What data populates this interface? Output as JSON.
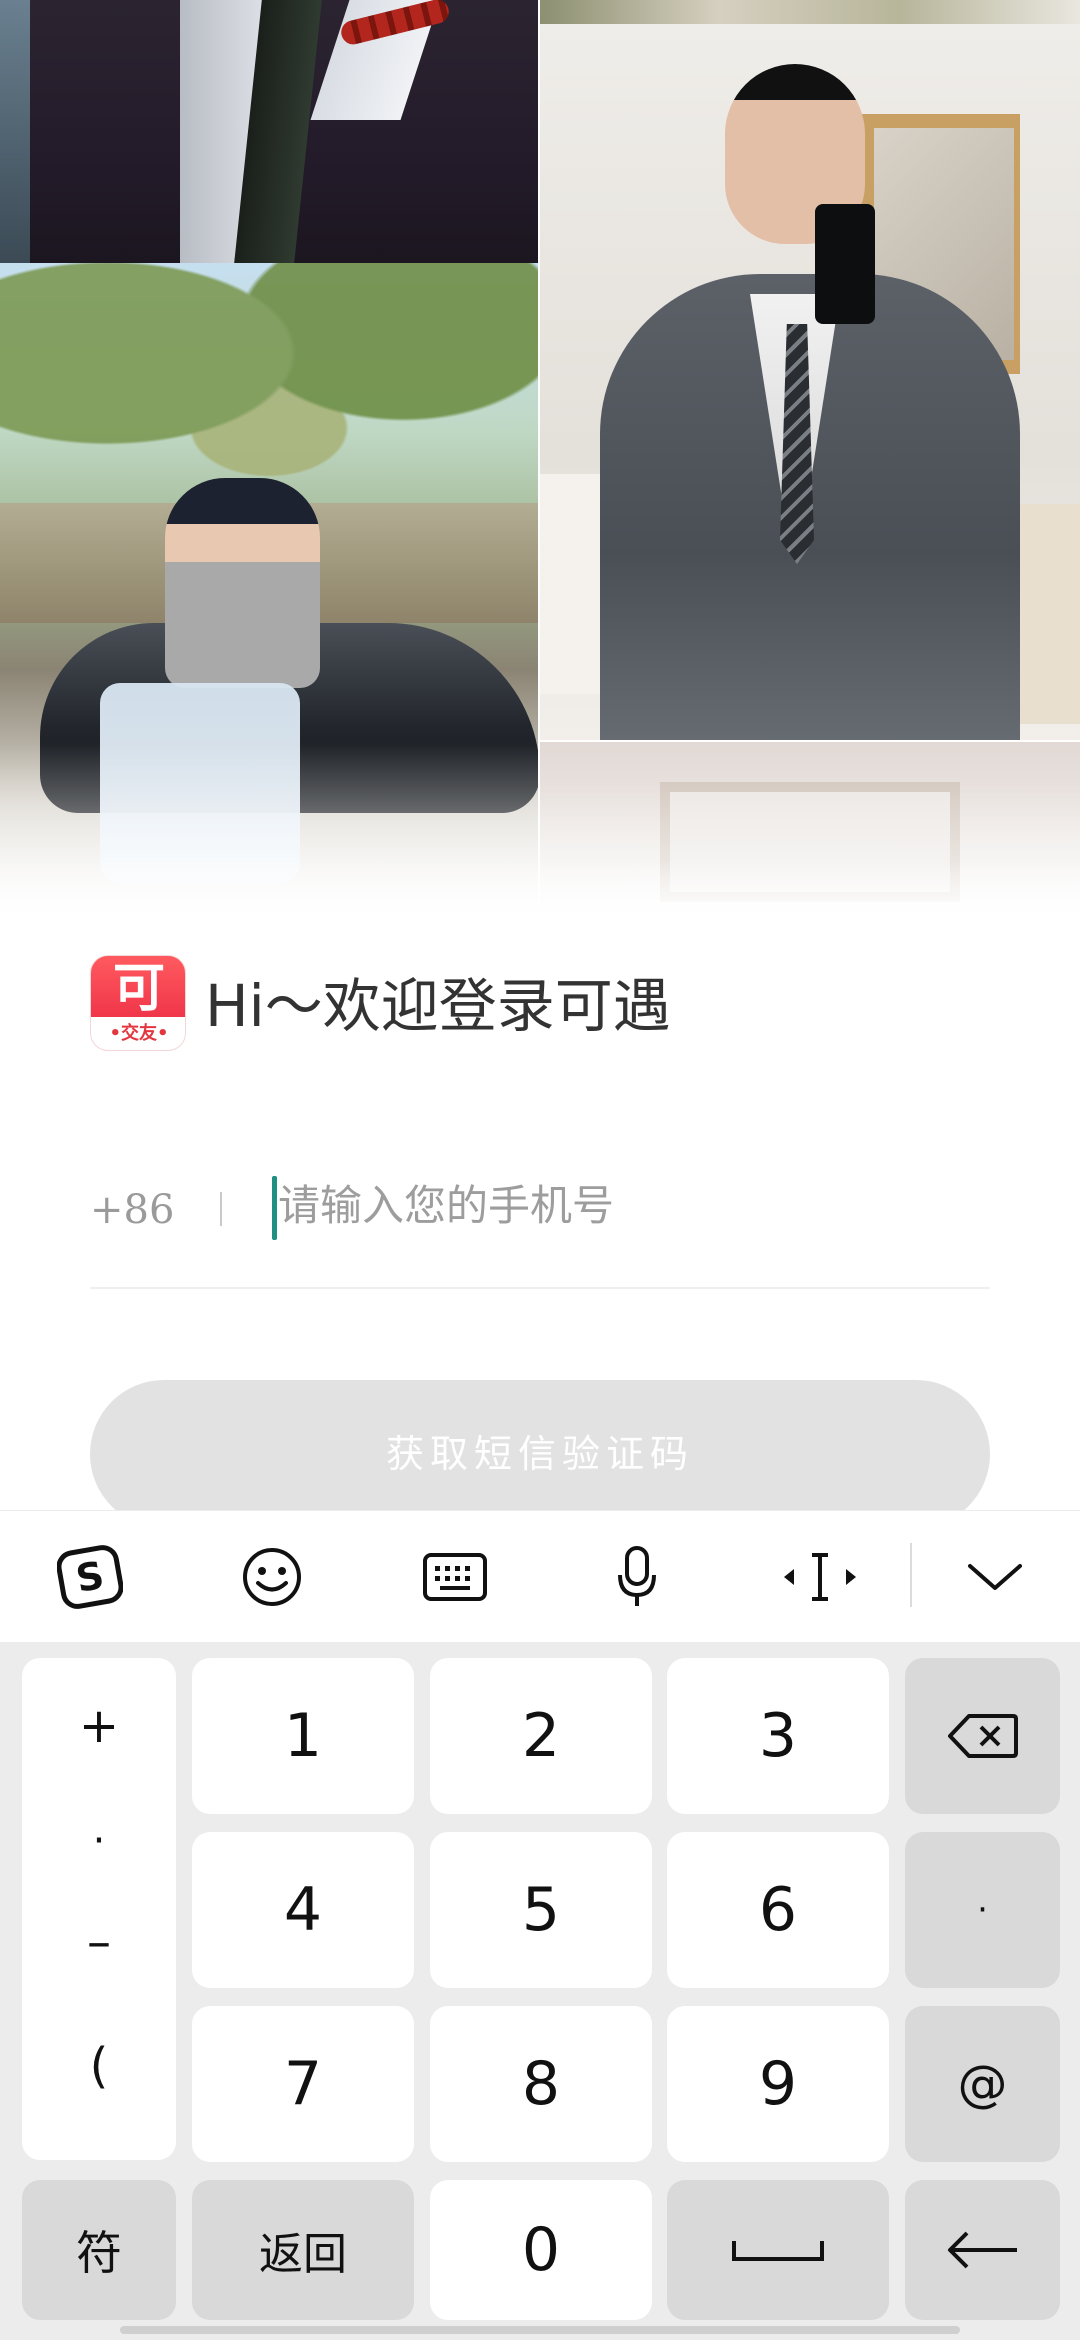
{
  "brand": {
    "logo_glyph": "可",
    "logo_sub": "•交友•",
    "welcome": "Hi～欢迎登录可遇"
  },
  "login": {
    "country_code": "+86",
    "separator": "|",
    "phone_placeholder": "请输入您的手机号",
    "phone_value": "",
    "sms_button_label": "获取短信验证码",
    "sms_button_enabled": false
  },
  "keyboard": {
    "toolbar": [
      {
        "name": "sogou-logo-icon"
      },
      {
        "name": "emoji-icon"
      },
      {
        "name": "keyboard-switch-icon"
      },
      {
        "name": "microphone-icon"
      },
      {
        "name": "cursor-move-icon"
      },
      {
        "name": "collapse-keyboard-icon"
      }
    ],
    "symbol_column": [
      "+",
      "·",
      "–",
      "("
    ],
    "digits": [
      "1",
      "2",
      "3",
      "4",
      "5",
      "6",
      "7",
      "8",
      "9",
      "0"
    ],
    "right_keys": {
      "dot": "·",
      "at": "@"
    },
    "bottom_row": {
      "symbols": "符",
      "back": "返回"
    }
  },
  "colors": {
    "brand_red": "#f0364a",
    "caret_teal": "#1f8f84",
    "button_disabled": "#e2e2e2",
    "keyboard_bg": "#ececec"
  }
}
